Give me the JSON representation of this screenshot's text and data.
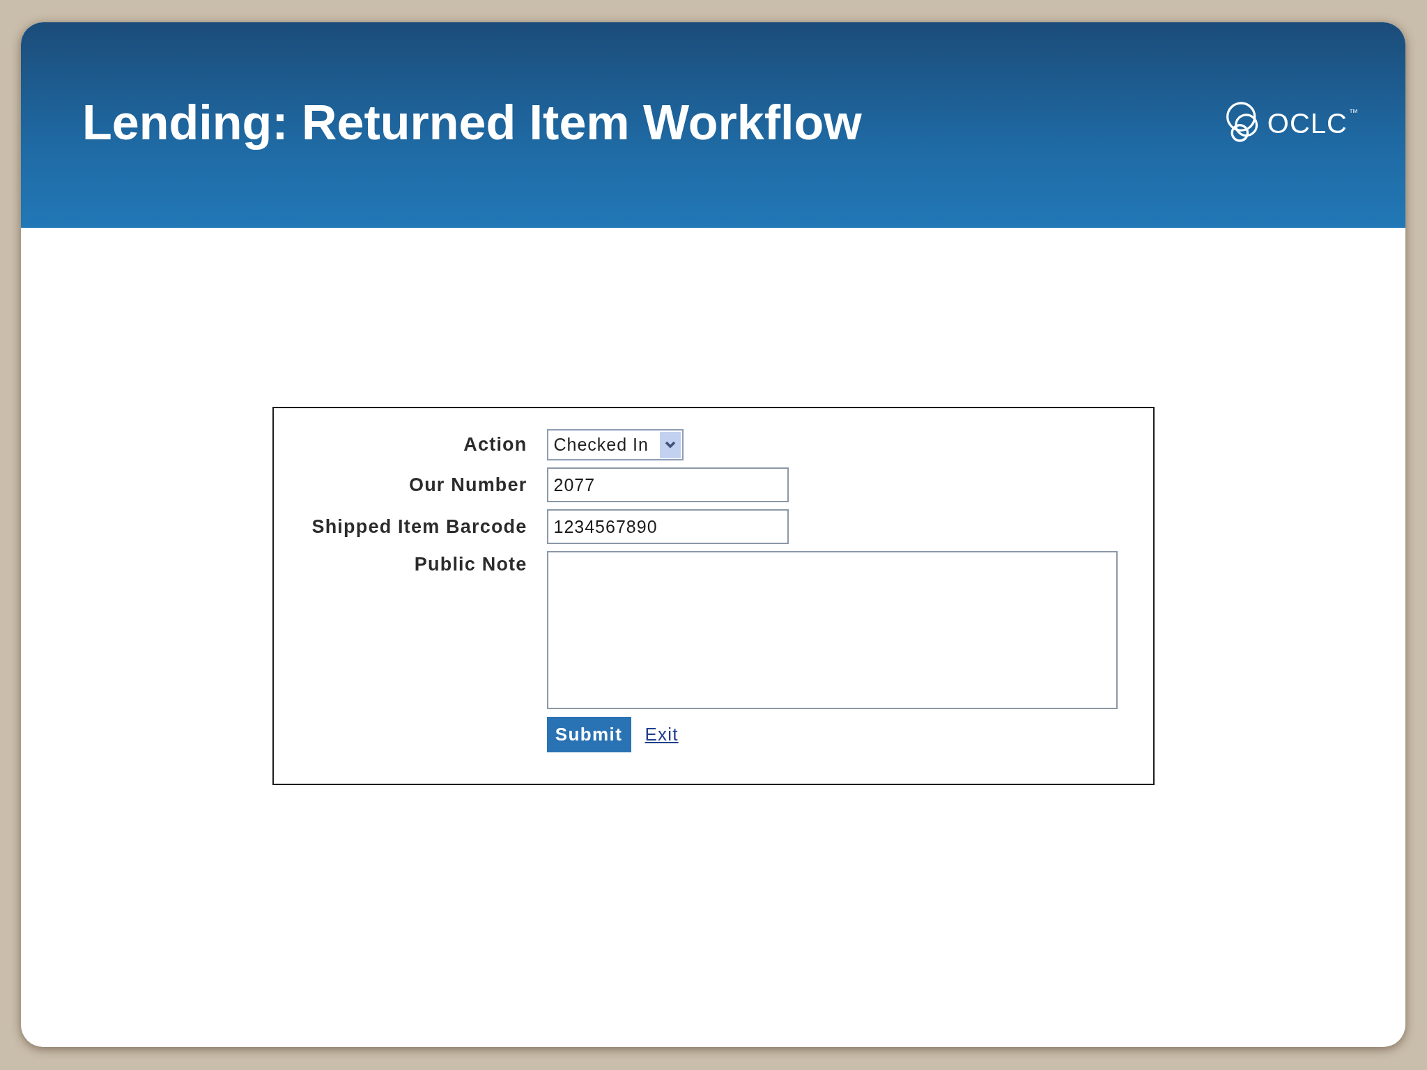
{
  "header": {
    "title": "Lending: Returned Item Workflow",
    "logo": {
      "text": "OCLC",
      "mark": "™"
    }
  },
  "form": {
    "fields": [
      {
        "kind": "select",
        "label": "Action",
        "value": "Checked In"
      },
      {
        "kind": "text",
        "label": "Our Number",
        "value": "2077"
      },
      {
        "kind": "text",
        "label": "Shipped Item Barcode",
        "value": "1234567890"
      },
      {
        "kind": "textarea",
        "label": "Public Note"
      }
    ],
    "actions": [
      {
        "kind": "button",
        "label": "Submit"
      },
      {
        "kind": "link",
        "label": "Exit"
      }
    ]
  }
}
